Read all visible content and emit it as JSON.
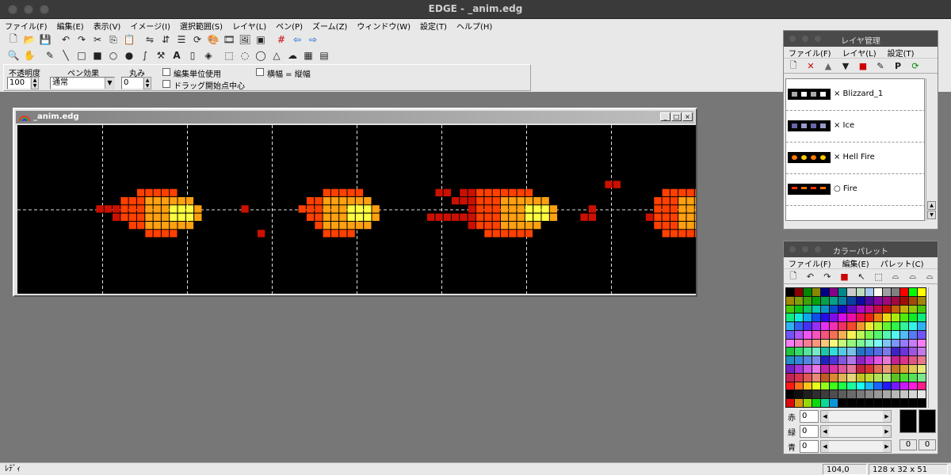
{
  "window": {
    "title": "EDGE - _anim.edg"
  },
  "menu": [
    "ファイル(F)",
    "編集(E)",
    "表示(V)",
    "イメージ(I)",
    "選択範囲(S)",
    "レイヤ(L)",
    "ペン(P)",
    "ズーム(Z)",
    "ウィンドウ(W)",
    "設定(T)",
    "ヘルプ(H)"
  ],
  "options": {
    "opacity_label": "不透明度",
    "opacity_value": "100",
    "pen_effect_label": "ペン効果",
    "pen_effect_value": "通常",
    "round_label": "丸み",
    "round_value": "0",
    "edit_unit_label": "編集単位使用",
    "drag_center_label": "ドラッグ開始点中心",
    "aspect_label": "横幅 = 縦幅"
  },
  "document": {
    "title": "_anim.edg",
    "frames": 8,
    "grid_cols": 128,
    "grid_rows": 32,
    "sprites": [
      {
        "frame": 0,
        "cells": [
          [
            11,
            2
          ],
          [
            12,
            2
          ],
          [
            13,
            2
          ],
          [
            14,
            2
          ],
          [
            15,
            2
          ],
          [
            9,
            3
          ],
          [
            10,
            3
          ],
          [
            11,
            3
          ],
          [
            12,
            3
          ],
          [
            13,
            3
          ],
          [
            14,
            3
          ],
          [
            15,
            3
          ],
          [
            16,
            3
          ],
          [
            17,
            3
          ],
          [
            6,
            4
          ],
          [
            7,
            4
          ],
          [
            8,
            4
          ],
          [
            9,
            4
          ],
          [
            10,
            4
          ],
          [
            11,
            4
          ],
          [
            12,
            4
          ],
          [
            13,
            4
          ],
          [
            14,
            4
          ],
          [
            15,
            4
          ],
          [
            16,
            4
          ],
          [
            17,
            4
          ],
          [
            18,
            4
          ],
          [
            8,
            5
          ],
          [
            9,
            5
          ],
          [
            10,
            5
          ],
          [
            11,
            5
          ],
          [
            12,
            5
          ],
          [
            13,
            5
          ],
          [
            14,
            5
          ],
          [
            15,
            5
          ],
          [
            16,
            5
          ],
          [
            17,
            5
          ],
          [
            18,
            5
          ],
          [
            10,
            6
          ],
          [
            11,
            6
          ],
          [
            12,
            6
          ],
          [
            13,
            6
          ],
          [
            14,
            6
          ],
          [
            15,
            6
          ],
          [
            16,
            6
          ],
          [
            17,
            6
          ],
          [
            12,
            7
          ],
          [
            13,
            7
          ],
          [
            14,
            7
          ],
          [
            15,
            7
          ]
        ]
      },
      {
        "frame": 2,
        "cells": [
          [
            3,
            4
          ],
          [
            5,
            7
          ],
          [
            13,
            2
          ],
          [
            14,
            2
          ],
          [
            15,
            2
          ],
          [
            16,
            2
          ],
          [
            17,
            2
          ],
          [
            11,
            3
          ],
          [
            12,
            3
          ],
          [
            13,
            3
          ],
          [
            14,
            3
          ],
          [
            15,
            3
          ],
          [
            16,
            3
          ],
          [
            17,
            3
          ],
          [
            18,
            3
          ],
          [
            10,
            4
          ],
          [
            11,
            4
          ],
          [
            12,
            4
          ],
          [
            13,
            4
          ],
          [
            14,
            4
          ],
          [
            15,
            4
          ],
          [
            16,
            4
          ],
          [
            17,
            4
          ],
          [
            18,
            4
          ],
          [
            19,
            4
          ],
          [
            11,
            5
          ],
          [
            12,
            5
          ],
          [
            13,
            5
          ],
          [
            14,
            5
          ],
          [
            15,
            5
          ],
          [
            16,
            5
          ],
          [
            17,
            5
          ],
          [
            18,
            5
          ],
          [
            19,
            5
          ],
          [
            12,
            6
          ],
          [
            13,
            6
          ],
          [
            14,
            6
          ],
          [
            15,
            6
          ],
          [
            16,
            6
          ],
          [
            17,
            6
          ],
          [
            18,
            6
          ],
          [
            13,
            7
          ],
          [
            14,
            7
          ],
          [
            15,
            7
          ],
          [
            16,
            7
          ]
        ]
      },
      {
        "frame": 4,
        "cells": [
          [
            6,
            2
          ],
          [
            7,
            2
          ],
          [
            9,
            2
          ],
          [
            10,
            2
          ],
          [
            11,
            2
          ],
          [
            12,
            2
          ],
          [
            13,
            2
          ],
          [
            14,
            2
          ],
          [
            15,
            2
          ],
          [
            16,
            2
          ],
          [
            17,
            2
          ],
          [
            8,
            3
          ],
          [
            9,
            3
          ],
          [
            10,
            3
          ],
          [
            11,
            3
          ],
          [
            12,
            3
          ],
          [
            13,
            3
          ],
          [
            14,
            3
          ],
          [
            15,
            3
          ],
          [
            16,
            3
          ],
          [
            17,
            3
          ],
          [
            18,
            3
          ],
          [
            19,
            3
          ],
          [
            10,
            4
          ],
          [
            11,
            4
          ],
          [
            12,
            4
          ],
          [
            13,
            4
          ],
          [
            14,
            4
          ],
          [
            15,
            4
          ],
          [
            16,
            4
          ],
          [
            17,
            4
          ],
          [
            18,
            4
          ],
          [
            19,
            4
          ],
          [
            20,
            4
          ],
          [
            5,
            5
          ],
          [
            6,
            5
          ],
          [
            7,
            5
          ],
          [
            8,
            5
          ],
          [
            9,
            5
          ],
          [
            10,
            5
          ],
          [
            11,
            5
          ],
          [
            12,
            5
          ],
          [
            13,
            5
          ],
          [
            14,
            5
          ],
          [
            15,
            5
          ],
          [
            16,
            5
          ],
          [
            17,
            5
          ],
          [
            18,
            5
          ],
          [
            19,
            5
          ],
          [
            20,
            5
          ],
          [
            10,
            6
          ],
          [
            11,
            6
          ],
          [
            12,
            6
          ],
          [
            13,
            6
          ],
          [
            14,
            6
          ],
          [
            15,
            6
          ],
          [
            16,
            6
          ],
          [
            17,
            6
          ],
          [
            18,
            6
          ],
          [
            12,
            7
          ],
          [
            13,
            7
          ],
          [
            14,
            7
          ],
          [
            15,
            7
          ],
          [
            16,
            7
          ],
          [
            17,
            7
          ]
        ]
      },
      {
        "frame": 6,
        "cells": [
          [
            6,
            1
          ],
          [
            7,
            1
          ],
          [
            13,
            2
          ],
          [
            14,
            2
          ],
          [
            15,
            2
          ],
          [
            16,
            2
          ],
          [
            17,
            2
          ],
          [
            12,
            3
          ],
          [
            13,
            3
          ],
          [
            14,
            3
          ],
          [
            15,
            3
          ],
          [
            16,
            3
          ],
          [
            17,
            3
          ],
          [
            18,
            3
          ],
          [
            19,
            3
          ],
          [
            4,
            4
          ],
          [
            12,
            4
          ],
          [
            13,
            4
          ],
          [
            14,
            4
          ],
          [
            15,
            4
          ],
          [
            16,
            4
          ],
          [
            17,
            4
          ],
          [
            18,
            4
          ],
          [
            19,
            4
          ],
          [
            20,
            4
          ],
          [
            21,
            4
          ],
          [
            3,
            5
          ],
          [
            4,
            5
          ],
          [
            11,
            5
          ],
          [
            12,
            5
          ],
          [
            13,
            5
          ],
          [
            14,
            5
          ],
          [
            15,
            5
          ],
          [
            16,
            5
          ],
          [
            17,
            5
          ],
          [
            18,
            5
          ],
          [
            19,
            5
          ],
          [
            20,
            5
          ],
          [
            12,
            6
          ],
          [
            13,
            6
          ],
          [
            14,
            6
          ],
          [
            15,
            6
          ],
          [
            16,
            6
          ],
          [
            17,
            6
          ],
          [
            18,
            6
          ],
          [
            19,
            6
          ],
          [
            13,
            7
          ],
          [
            14,
            7
          ],
          [
            15,
            7
          ],
          [
            16,
            7
          ],
          [
            17,
            7
          ]
        ]
      }
    ]
  },
  "layer_panel": {
    "title": "レイヤ管理",
    "menu": [
      "ファイル(F)",
      "レイヤ(L)",
      "設定(T)"
    ],
    "layers": [
      {
        "name": "× Blizzard_1",
        "thumb": "blizzard"
      },
      {
        "name": "× Ice",
        "thumb": "ice"
      },
      {
        "name": "× Hell Fire",
        "thumb": "hellfire"
      },
      {
        "name": "○ Fire",
        "thumb": "fire"
      }
    ]
  },
  "palette_panel": {
    "title": "カラーパレット",
    "menu": [
      "ファイル(F)",
      "編集(E)",
      "パレット(C)"
    ],
    "red_label": "赤",
    "green_label": "緑",
    "blue_label": "青",
    "red_value": "0",
    "green_value": "0",
    "blue_value": "0",
    "fg_index": "0",
    "bg_index": "0"
  },
  "status": {
    "message": "ﾚﾃﾞｨ",
    "coords": "104,0",
    "size": "128 x 32 x 51"
  },
  "colors": {
    "fire_core": "#ffff40",
    "fire_mid": "#ffa010",
    "fire_outer": "#ff4000",
    "fire_edge": "#cc1000",
    "canvas_bg": "#000000"
  }
}
